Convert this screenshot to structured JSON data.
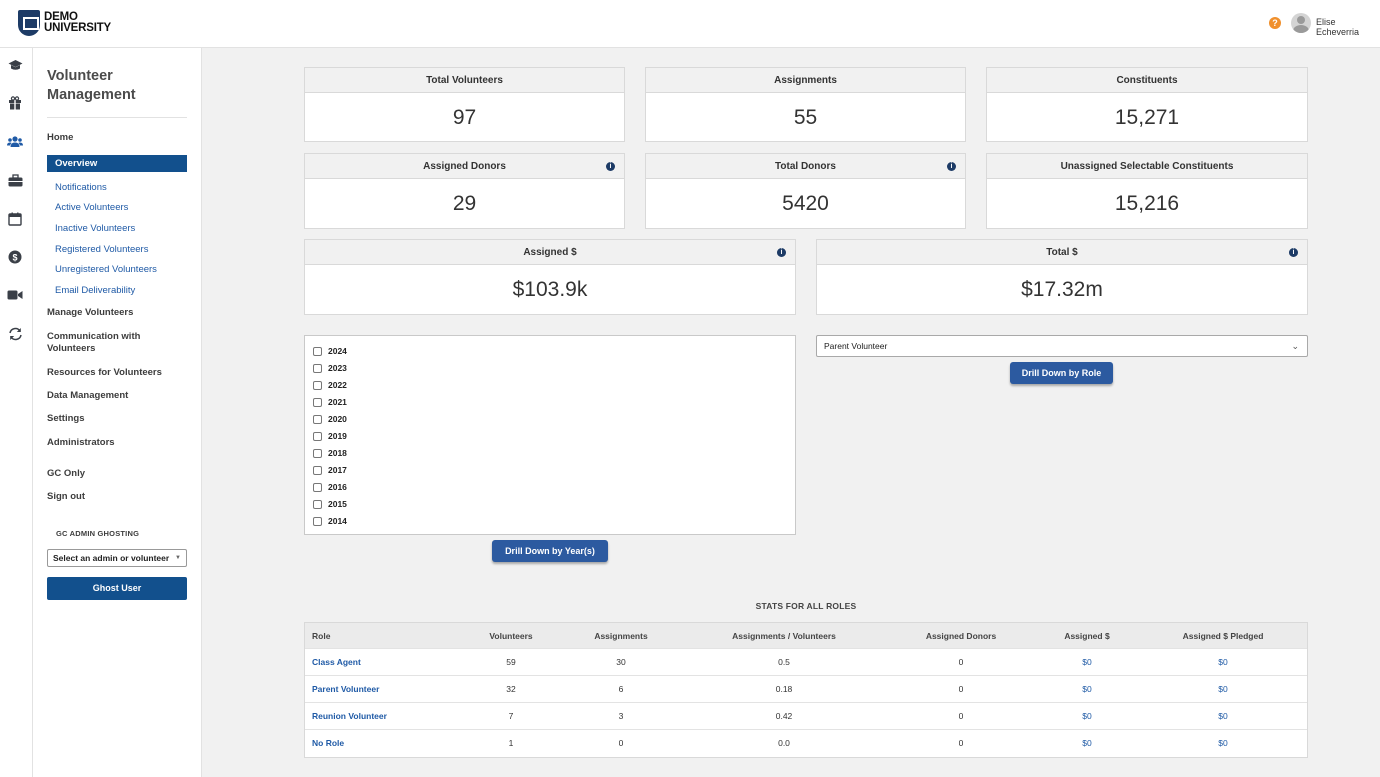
{
  "header": {
    "logo_line1": "DEMO",
    "logo_line2": "UNIVERSITY",
    "help": "?",
    "user_name": "Elise Echeverria"
  },
  "rail": {
    "icons": [
      "graduation-cap-icon",
      "gift-icon",
      "users-icon",
      "briefcase-icon",
      "calendar-icon",
      "dollar-icon",
      "video-icon",
      "sync-icon"
    ],
    "active": "users-icon"
  },
  "sidebar": {
    "title": "Volunteer Management",
    "home": "Home",
    "overview": "Overview",
    "sub_items": [
      "Notifications",
      "Active Volunteers",
      "Inactive Volunteers",
      "Registered Volunteers",
      "Unregistered Volunteers",
      "Email Deliverability"
    ],
    "manage": "Manage Volunteers",
    "communication": "Communication with Volunteers",
    "resources": "Resources for Volunteers",
    "data_mgmt": "Data Management",
    "settings": "Settings",
    "administrators": "Administrators",
    "gc_only": "GC Only",
    "sign_out": "Sign out",
    "ghost_label": "GC ADMIN GHOSTING",
    "ghost_select": "Select an admin or volunteer",
    "ghost_button": "Ghost User"
  },
  "cards": {
    "total_volunteers": {
      "label": "Total Volunteers",
      "value": "97"
    },
    "assignments": {
      "label": "Assignments",
      "value": "55"
    },
    "constituents": {
      "label": "Constituents",
      "value": "15,271"
    },
    "assigned_donors": {
      "label": "Assigned Donors",
      "value": "29"
    },
    "total_donors": {
      "label": "Total Donors",
      "value": "5420"
    },
    "unassigned": {
      "label": "Unassigned Selectable Constituents",
      "value": "15,216"
    },
    "assigned_dollars": {
      "label": "Assigned $",
      "value": "$103.9k"
    },
    "total_dollars": {
      "label": "Total $",
      "value": "$17.32m"
    }
  },
  "years": [
    "2024",
    "2023",
    "2022",
    "2021",
    "2020",
    "2019",
    "2018",
    "2017",
    "2016",
    "2015",
    "2014"
  ],
  "drill_year_button": "Drill Down by Year(s)",
  "role_select_value": "Parent Volunteer",
  "drill_role_button": "Drill Down by Role",
  "stats": {
    "title": "STATS FOR ALL ROLES",
    "columns": [
      "Role",
      "Volunteers",
      "Assignments",
      "Assignments / Volunteers",
      "Assigned Donors",
      "Assigned $",
      "Assigned $ Pledged"
    ],
    "rows": [
      [
        "Class Agent",
        "59",
        "30",
        "0.5",
        "0",
        "$0",
        "$0"
      ],
      [
        "Parent Volunteer",
        "32",
        "6",
        "0.18",
        "0",
        "$0",
        "$0"
      ],
      [
        "Reunion Volunteer",
        "7",
        "3",
        "0.42",
        "0",
        "$0",
        "$0"
      ],
      [
        "No Role",
        "1",
        "0",
        "0.0",
        "0",
        "$0",
        "$0"
      ]
    ]
  },
  "colors": {
    "brand_navy": "#12508d",
    "button_blue": "#2c5aa0",
    "link_blue": "#1f5aa6",
    "help_orange": "#f0902d"
  }
}
